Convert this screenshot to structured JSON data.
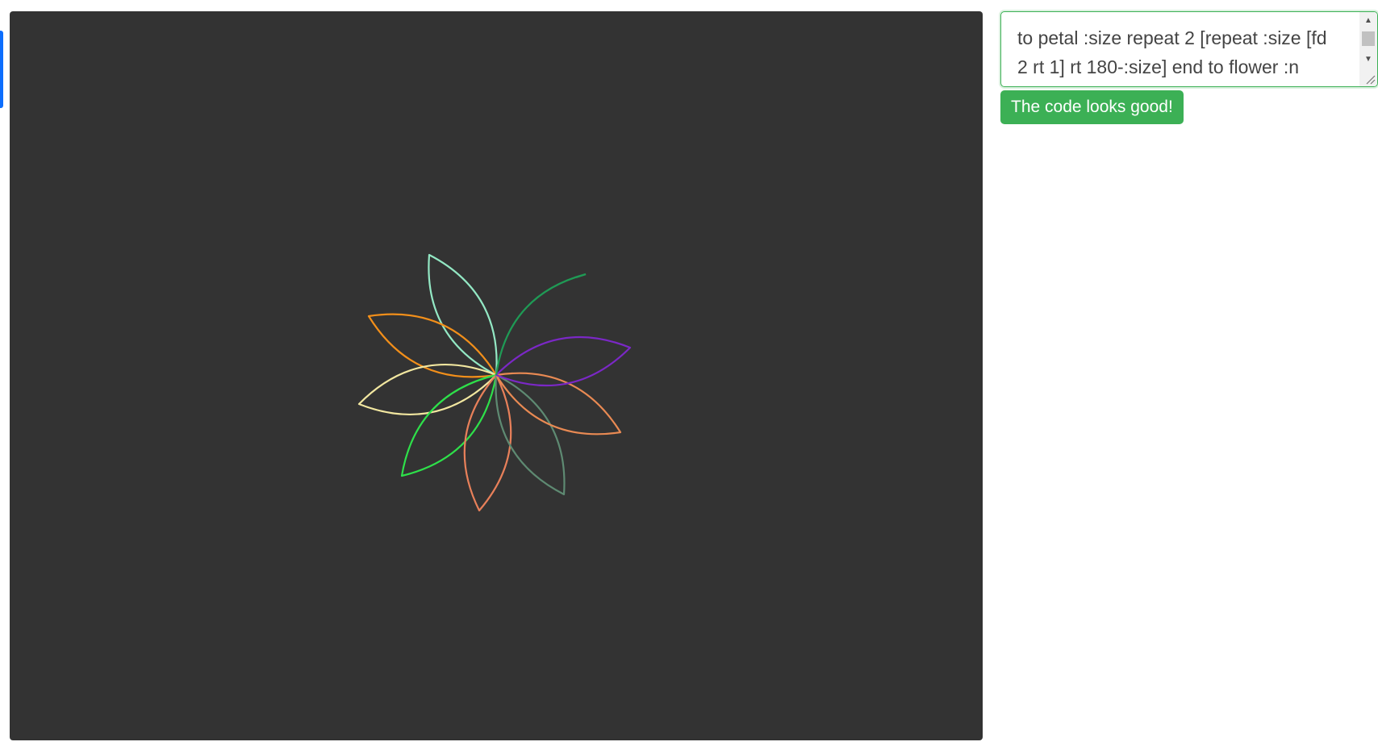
{
  "editor": {
    "code": "to petal :size repeat 2 [repeat :size [fd 2 rt 1] rt 180-:size] end to flower :n"
  },
  "status": {
    "message": "The code looks good!",
    "color": "#3cb055"
  },
  "canvas": {
    "background": "#333333",
    "petal_colors": [
      "#1f9a55",
      "#7b28c6",
      "#e98a53",
      "#5e8a72",
      "#e8805a",
      "#2ee04a",
      "#f2e7a0",
      "#f28f1a",
      "#93e8c4"
    ]
  },
  "accent": {
    "color": "#0d6efd"
  }
}
